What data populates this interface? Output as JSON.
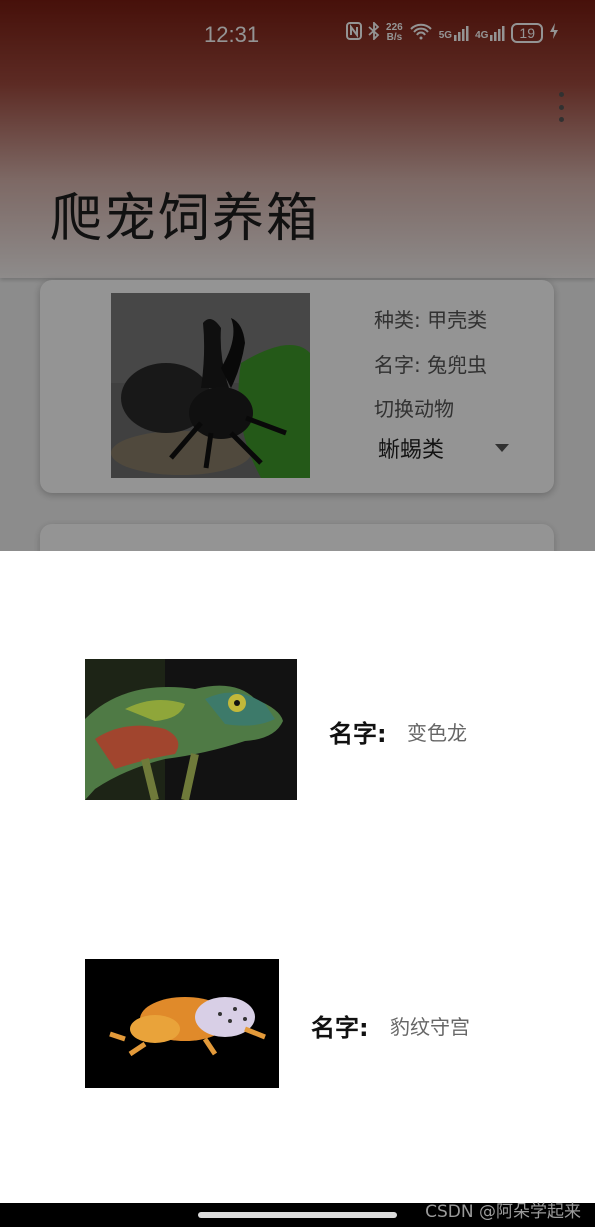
{
  "status_bar": {
    "time": "12:31",
    "speed_value": "226",
    "speed_unit": "B/s",
    "net_5g": "5G",
    "net_4g": "4G",
    "battery": "19",
    "icons": [
      "nfc-icon",
      "bluetooth-icon",
      "wifi-icon",
      "signal-5g-icon",
      "signal-4g-icon",
      "battery-icon",
      "charging-icon"
    ]
  },
  "app": {
    "title": "爬宠饲养箱"
  },
  "card": {
    "image_icon": "rhinoceros-beetle-photo",
    "type_label": "种类:",
    "type_value": "甲壳类",
    "name_label": "名字:",
    "name_value": "兔兜虫",
    "switch_label": "切换动物",
    "dropdown_value": "蜥蜴类"
  },
  "sheet": {
    "items": [
      {
        "image_icon": "chameleon-photo",
        "name_label": "名字:",
        "name_value": "变色龙"
      },
      {
        "image_icon": "leopard-gecko-photo",
        "name_label": "名字:",
        "name_value": "豹纹守宫"
      }
    ]
  },
  "watermark": "CSDN @阿朵学起来",
  "colors": {
    "header_top": "#7a1d12",
    "scrim": "#000000",
    "nav_bar": "#000000"
  }
}
